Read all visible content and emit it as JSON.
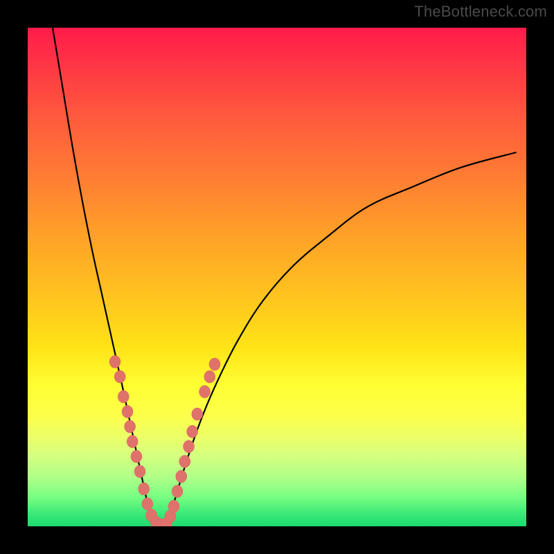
{
  "watermark": "TheBottleneck.com",
  "chart_data": {
    "type": "line",
    "title": "",
    "xlabel": "",
    "ylabel": "",
    "xlim": [
      0,
      100
    ],
    "ylim": [
      0,
      100
    ],
    "grid": false,
    "background": "rainbow_gradient_red_top_green_bottom",
    "curve_left": {
      "x": [
        5,
        7,
        9,
        11,
        13,
        15,
        17,
        19,
        20.5,
        22,
        23.5,
        25
      ],
      "y": [
        100,
        88,
        76,
        65,
        55,
        46,
        37,
        28,
        21,
        14,
        7,
        0
      ]
    },
    "curve_right": {
      "x": [
        28,
        30,
        32.5,
        35,
        38,
        42,
        47,
        53,
        60,
        68,
        77,
        87,
        98
      ],
      "y": [
        0,
        7,
        15,
        22,
        29,
        37,
        45,
        52,
        58,
        64,
        68,
        72,
        75
      ]
    },
    "dots_left": [
      {
        "x": 17.5,
        "y": 33
      },
      {
        "x": 18.5,
        "y": 30
      },
      {
        "x": 19.2,
        "y": 26
      },
      {
        "x": 20.0,
        "y": 23
      },
      {
        "x": 20.5,
        "y": 20
      },
      {
        "x": 21.0,
        "y": 17
      },
      {
        "x": 21.8,
        "y": 14
      },
      {
        "x": 22.5,
        "y": 11
      },
      {
        "x": 23.3,
        "y": 7.5
      },
      {
        "x": 24.0,
        "y": 4.5
      },
      {
        "x": 24.8,
        "y": 2.2
      },
      {
        "x": 25.7,
        "y": 0.8
      },
      {
        "x": 26.6,
        "y": 0.3
      }
    ],
    "dots_right": [
      {
        "x": 27.8,
        "y": 0.5
      },
      {
        "x": 28.6,
        "y": 2.0
      },
      {
        "x": 29.3,
        "y": 4.0
      },
      {
        "x": 30.0,
        "y": 7.0
      },
      {
        "x": 30.8,
        "y": 10.0
      },
      {
        "x": 31.5,
        "y": 13.0
      },
      {
        "x": 32.3,
        "y": 16.0
      },
      {
        "x": 33.0,
        "y": 19.0
      },
      {
        "x": 34.0,
        "y": 22.5
      },
      {
        "x": 35.5,
        "y": 27.0
      },
      {
        "x": 36.5,
        "y": 30.0
      },
      {
        "x": 37.5,
        "y": 32.5
      }
    ]
  }
}
